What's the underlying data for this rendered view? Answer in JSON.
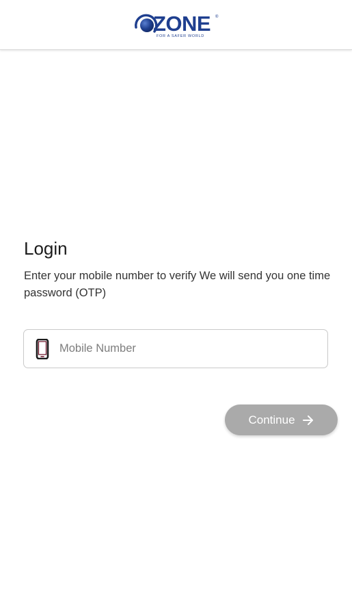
{
  "header": {
    "logo_text": "ZONE",
    "logo_tagline": "FOR A SAFER WORLD",
    "logo_registered": "®",
    "brand_color": "#1f3f8f"
  },
  "login": {
    "title": "Login",
    "description": "Enter your mobile number to verify We will send you one time password (OTP)",
    "mobile_field": {
      "placeholder": "Mobile Number",
      "value": "",
      "icon": "smartphone-icon",
      "icon_color": "#6b0f24"
    },
    "continue_button": {
      "label": "Continue",
      "icon": "arrow-right-icon",
      "color": "#aaaaaa",
      "state": "disabled"
    }
  }
}
